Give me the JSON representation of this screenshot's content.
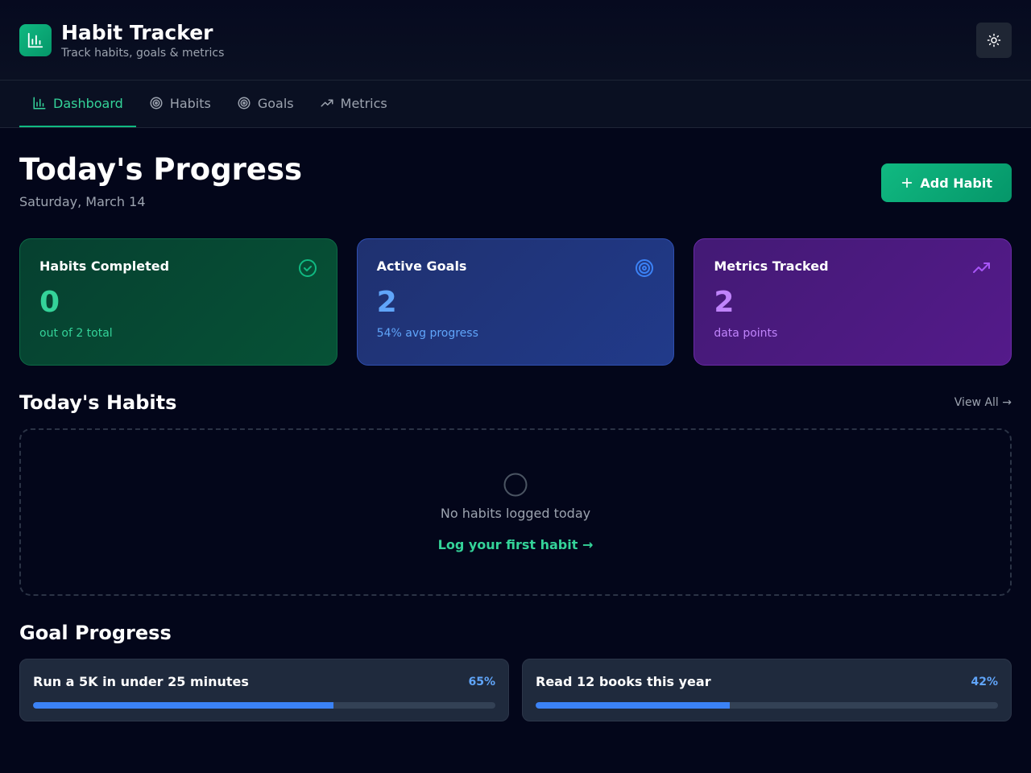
{
  "app": {
    "title": "Habit Tracker",
    "subtitle": "Track habits, goals & metrics",
    "brand_icon": "bar-chart-icon",
    "theme_toggle_icon": "sun-icon"
  },
  "nav": {
    "tabs": [
      {
        "label": "Dashboard",
        "icon": "bar-chart-icon",
        "active": true
      },
      {
        "label": "Habits",
        "icon": "target-icon",
        "active": false
      },
      {
        "label": "Goals",
        "icon": "target-icon",
        "active": false
      },
      {
        "label": "Metrics",
        "icon": "trending-up-icon",
        "active": false
      }
    ]
  },
  "page": {
    "title": "Today's Progress",
    "date": "Saturday, March 14",
    "add_button": "Add Habit"
  },
  "stats": [
    {
      "label": "Habits Completed",
      "value": "0",
      "sub": "out of 2 total",
      "icon": "check-circle-icon",
      "color": "#34d399"
    },
    {
      "label": "Active Goals",
      "value": "2",
      "sub": "54% avg progress",
      "icon": "target-icon",
      "color": "#60a5fa"
    },
    {
      "label": "Metrics Tracked",
      "value": "2",
      "sub": "data points",
      "icon": "trending-up-icon",
      "color": "#c084fc"
    }
  ],
  "habits_section": {
    "title": "Today's Habits",
    "view_all": "View All →",
    "empty_text": "No habits logged today",
    "empty_link": "Log your first habit →"
  },
  "goals_section": {
    "title": "Goal Progress",
    "goals": [
      {
        "name": "Run a 5K in under 25 minutes",
        "percent_label": "65%",
        "progress": 0.65
      },
      {
        "name": "Read 12 books this year",
        "percent_label": "42%",
        "progress": 0.42
      }
    ]
  },
  "colors": {
    "accent": "#10b981",
    "background": "#03061a",
    "progress_bar": "#3b82f6"
  }
}
